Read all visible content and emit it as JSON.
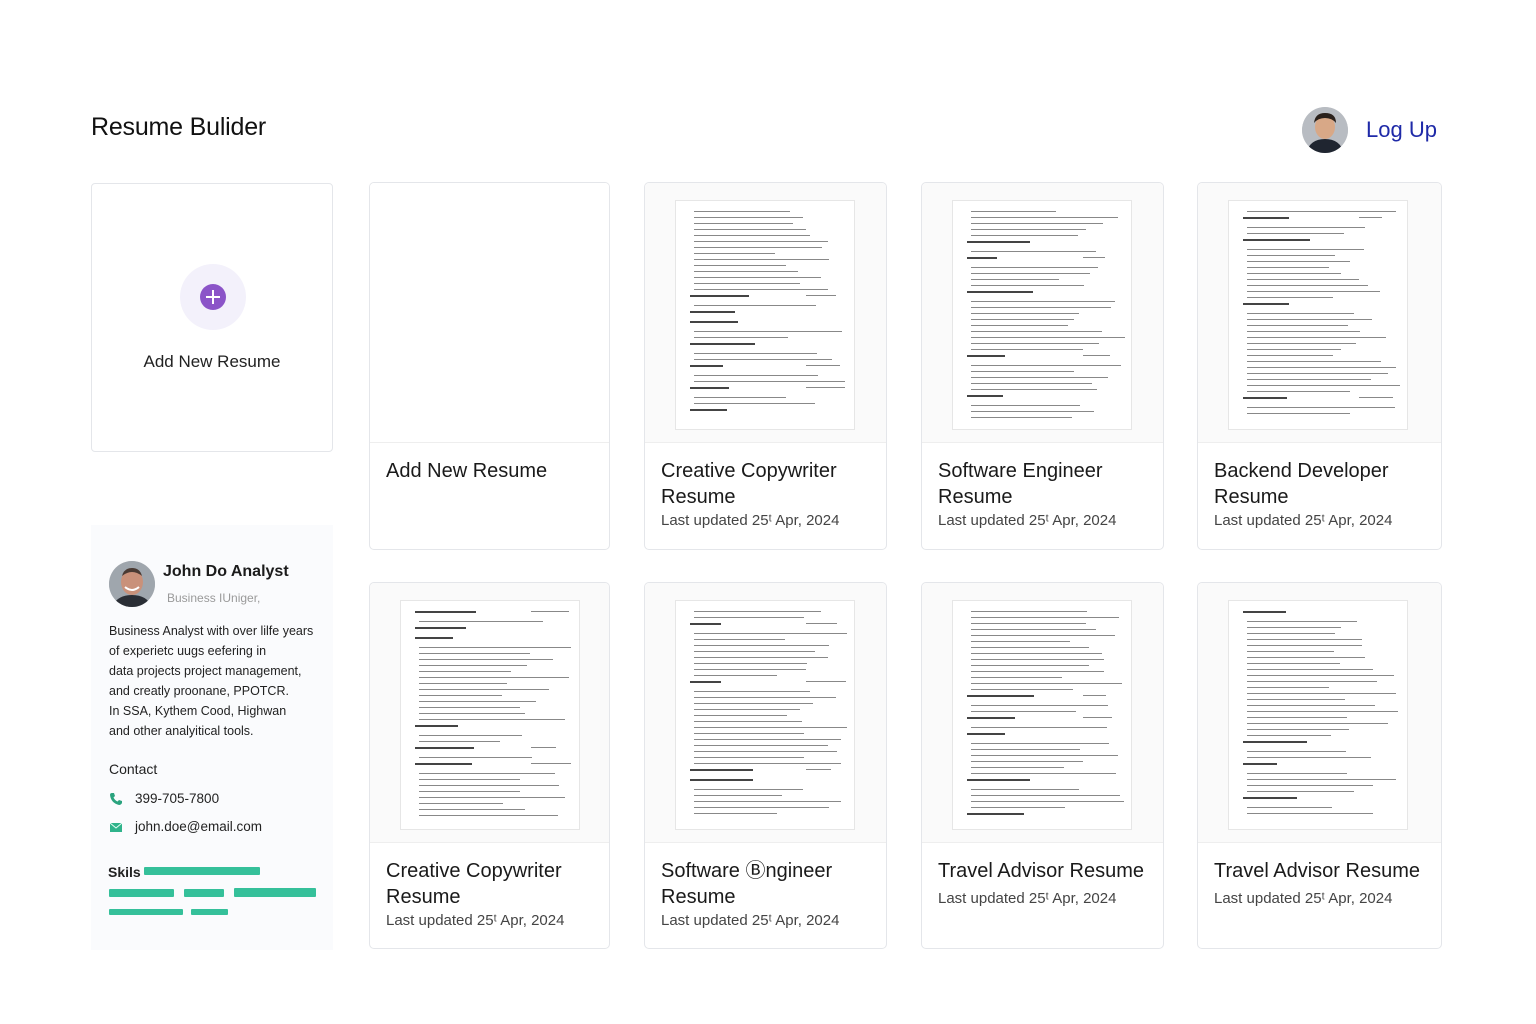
{
  "app": {
    "title": "Resume Bulider"
  },
  "header": {
    "login_label": "Log Up"
  },
  "add_card": {
    "label": "Add New Resume"
  },
  "cards": [
    {
      "title": "Add New Resume",
      "updated": ""
    },
    {
      "title": "Creative Copywriter Resume",
      "updated": "Last updated 25ᵗ Apr, 2024"
    },
    {
      "title": "Software Engineer Resume",
      "updated": "Last updated 25ᵗ Apr, 2024"
    },
    {
      "title": "Backend Developer Resume",
      "updated": "Last updated 25ᵗ Apr, 2024"
    },
    {
      "title": "Creative Copywriter Resume",
      "updated": "Last updated 25ᵗ Apr, 2024"
    },
    {
      "title": "Software Ⓑngineer Resume",
      "updated": "Last updated 25ᵗ Apr, 2024"
    },
    {
      "title": "Travel Advisor Resume",
      "updated": "Last updated 25ᵗ Apr, 2024"
    },
    {
      "title": "Travel Advisor Resume",
      "updated": "Last updated 25ᵗ Apr, 2024"
    }
  ],
  "profile": {
    "name": "John Do Analyst",
    "role": "Business IUniger,",
    "bio": [
      "Business Analyst with over lilfe years",
      "of experietc uugs eеfering in",
      "data projects project management,",
      "and creatly proonane, PPOTCR.",
      "In SSA, Kythem Cood, Highwan",
      "and other analyitical tools."
    ],
    "contact_label": "Contact",
    "phone": "399-705-7800",
    "email": "john.doe@email.com",
    "skills_label": "Skils"
  },
  "icons": [
    "plus-icon",
    "phone-icon",
    "email-icon"
  ],
  "colors": {
    "accent": "#8b54c8",
    "link": "#1f2aa8",
    "skill_bar": "#35c09a"
  }
}
